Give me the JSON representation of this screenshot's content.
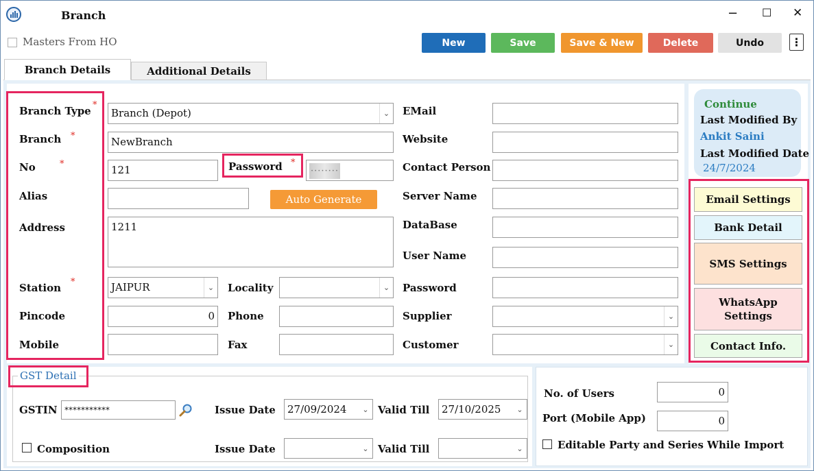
{
  "window": {
    "title": "Branch",
    "minimize": "−",
    "maximize": "☐",
    "close": "✕"
  },
  "toolbar": {
    "masters_from_ho": "Masters From HO",
    "new": "New",
    "save": "Save",
    "save_new": "Save & New",
    "delete": "Delete",
    "undo": "Undo",
    "more": "⋮"
  },
  "tabs": [
    "Branch Details",
    "Additional Details"
  ],
  "form": {
    "branch_type": {
      "label": "Branch Type",
      "value": "Branch (Depot)"
    },
    "branch": {
      "label": "Branch",
      "value": "NewBranch"
    },
    "no": {
      "label": "No",
      "value": "121"
    },
    "password": {
      "label": "Password",
      "value": "········"
    },
    "alias": {
      "label": "Alias",
      "value": ""
    },
    "auto_generate": "Auto Generate",
    "address": {
      "label": "Address",
      "value": "1211"
    },
    "station": {
      "label": "Station",
      "value": "JAIPUR"
    },
    "locality": {
      "label": "Locality",
      "value": ""
    },
    "pincode": {
      "label": "Pincode",
      "value": "0"
    },
    "phone": {
      "label": "Phone",
      "value": ""
    },
    "mobile": {
      "label": "Mobile",
      "value": ""
    },
    "fax": {
      "label": "Fax",
      "value": ""
    },
    "email": {
      "label": "EMail",
      "value": ""
    },
    "website": {
      "label": "Website",
      "value": ""
    },
    "contact_person": {
      "label": "Contact Person",
      "value": ""
    },
    "server_name": {
      "label": "Server Name",
      "value": ""
    },
    "database": {
      "label": "DataBase",
      "value": ""
    },
    "user_name": {
      "label": "User Name",
      "value": ""
    },
    "db_password": {
      "label": "Password",
      "value": ""
    },
    "supplier": {
      "label": "Supplier",
      "value": ""
    },
    "customer": {
      "label": "Customer",
      "value": ""
    },
    "required_mark": "*"
  },
  "info": {
    "continue": "Continue",
    "last_modified_by_label": "Last Modified By",
    "last_modified_by": "Ankit Saini",
    "last_modified_date_label": "Last Modified Date",
    "last_modified_date": "24/7/2024"
  },
  "side_buttons": {
    "email_settings": "Email Settings",
    "bank_detail": "Bank Detail",
    "sms_settings": "SMS Settings",
    "whatsapp_line1": "WhatsApp",
    "whatsapp_line2": "Settings",
    "contact_info": "Contact Info."
  },
  "gst": {
    "legend": "GST Detail",
    "gstin_label": "GSTIN",
    "gstin_value": "***********",
    "issue_date_label": "Issue Date",
    "issue_date": "27/09/2024",
    "valid_till_label": "Valid Till",
    "valid_till": "27/10/2025",
    "composition": "Composition",
    "issue_date2_label": "Issue Date",
    "issue_date2": "",
    "valid_till2_label": "Valid Till",
    "valid_till2": ""
  },
  "misc": {
    "no_of_users_label": "No. of Users",
    "no_of_users": "0",
    "port_label": "Port (Mobile App)",
    "port": "0",
    "editable_party": "Editable Party and Series While Import"
  },
  "colors": {
    "new": "#1f6db8",
    "save": "#5cb85c",
    "save_new": "#f0962e",
    "delete": "#e0695a",
    "undo": "#e2e2e2",
    "auto_generate": "#f59a36",
    "highlight": "#e5255f",
    "email_settings_bg": "#fdfbd4",
    "bank_detail_bg": "#e3f5fb",
    "sms_settings_bg": "#fde3cc",
    "whatsapp_bg": "#fde0e0",
    "contact_info_bg": "#eafbe8"
  }
}
